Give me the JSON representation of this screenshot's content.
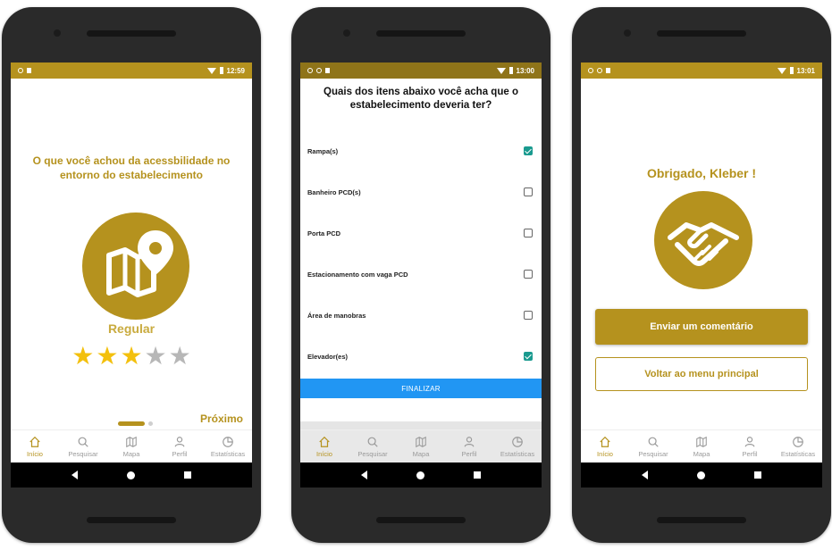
{
  "colors": {
    "accent": "#b5921e",
    "primary_blue": "#2196f3",
    "checkbox": "#1a9a8f",
    "star_on": "#f3c00d",
    "star_off": "#b7b7b7"
  },
  "screens": [
    {
      "status_time": "12:59",
      "question": "O que você achou da acessbilidade no entorno do estabelecimento",
      "icon": "map-pin-icon",
      "rating_label": "Regular",
      "rating": 3,
      "rating_max": 5,
      "next_label": "Próximo"
    },
    {
      "status_time": "13:00",
      "question": "Quais dos itens abaixo você acha que o estabelecimento deveria ter?",
      "options": [
        {
          "label": "Rampa(s)",
          "checked": true
        },
        {
          "label": "Banheiro PCD(s)",
          "checked": false
        },
        {
          "label": "Porta PCD",
          "checked": false
        },
        {
          "label": "Estacionamento com vaga PCD",
          "checked": false
        },
        {
          "label": "Área de manobras",
          "checked": false
        },
        {
          "label": "Elevador(es)",
          "checked": true
        }
      ],
      "submit_label": "FINALIZAR"
    },
    {
      "status_time": "13:01",
      "thanks": "Obrigado, Kleber !",
      "icon": "handshake-icon",
      "primary_button": "Enviar um comentário",
      "secondary_button": "Voltar ao menu principal"
    }
  ],
  "tabs": [
    {
      "label": "Início",
      "icon": "home-icon"
    },
    {
      "label": "Pesquisar",
      "icon": "search-icon"
    },
    {
      "label": "Mapa",
      "icon": "map-icon"
    },
    {
      "label": "Perfil",
      "icon": "user-icon"
    },
    {
      "label": "Estatísticas",
      "icon": "chart-icon"
    }
  ]
}
